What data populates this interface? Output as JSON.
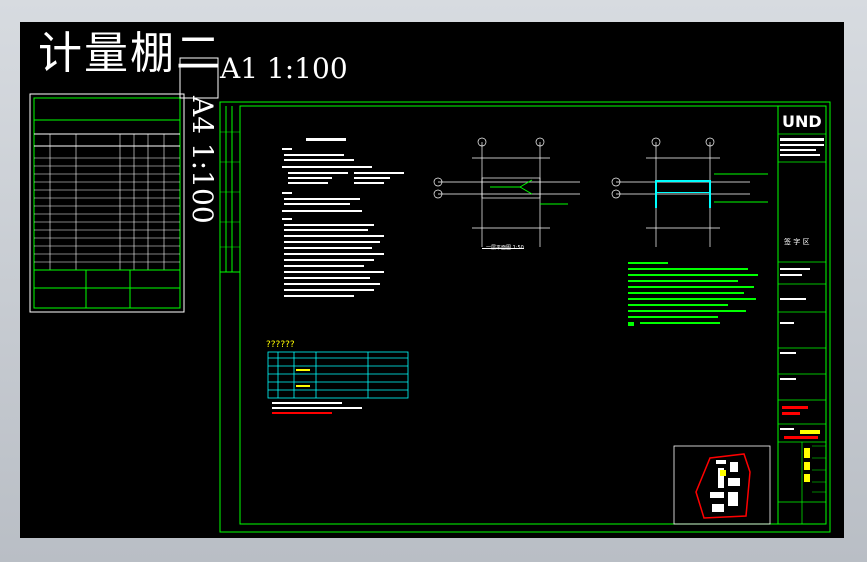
{
  "drawing": {
    "title": "计量棚二",
    "scale_a1": "A1 1:100",
    "scale_a4": "A4 1:100",
    "table_title": "??????",
    "plan_label": "一层平面图 1:50"
  },
  "colors": {
    "background": "#000000",
    "border": "#00ff00",
    "text": "#ffffff",
    "accent_cyan": "#00ffff",
    "accent_red": "#ff0000",
    "accent_yellow": "#ffff00"
  }
}
